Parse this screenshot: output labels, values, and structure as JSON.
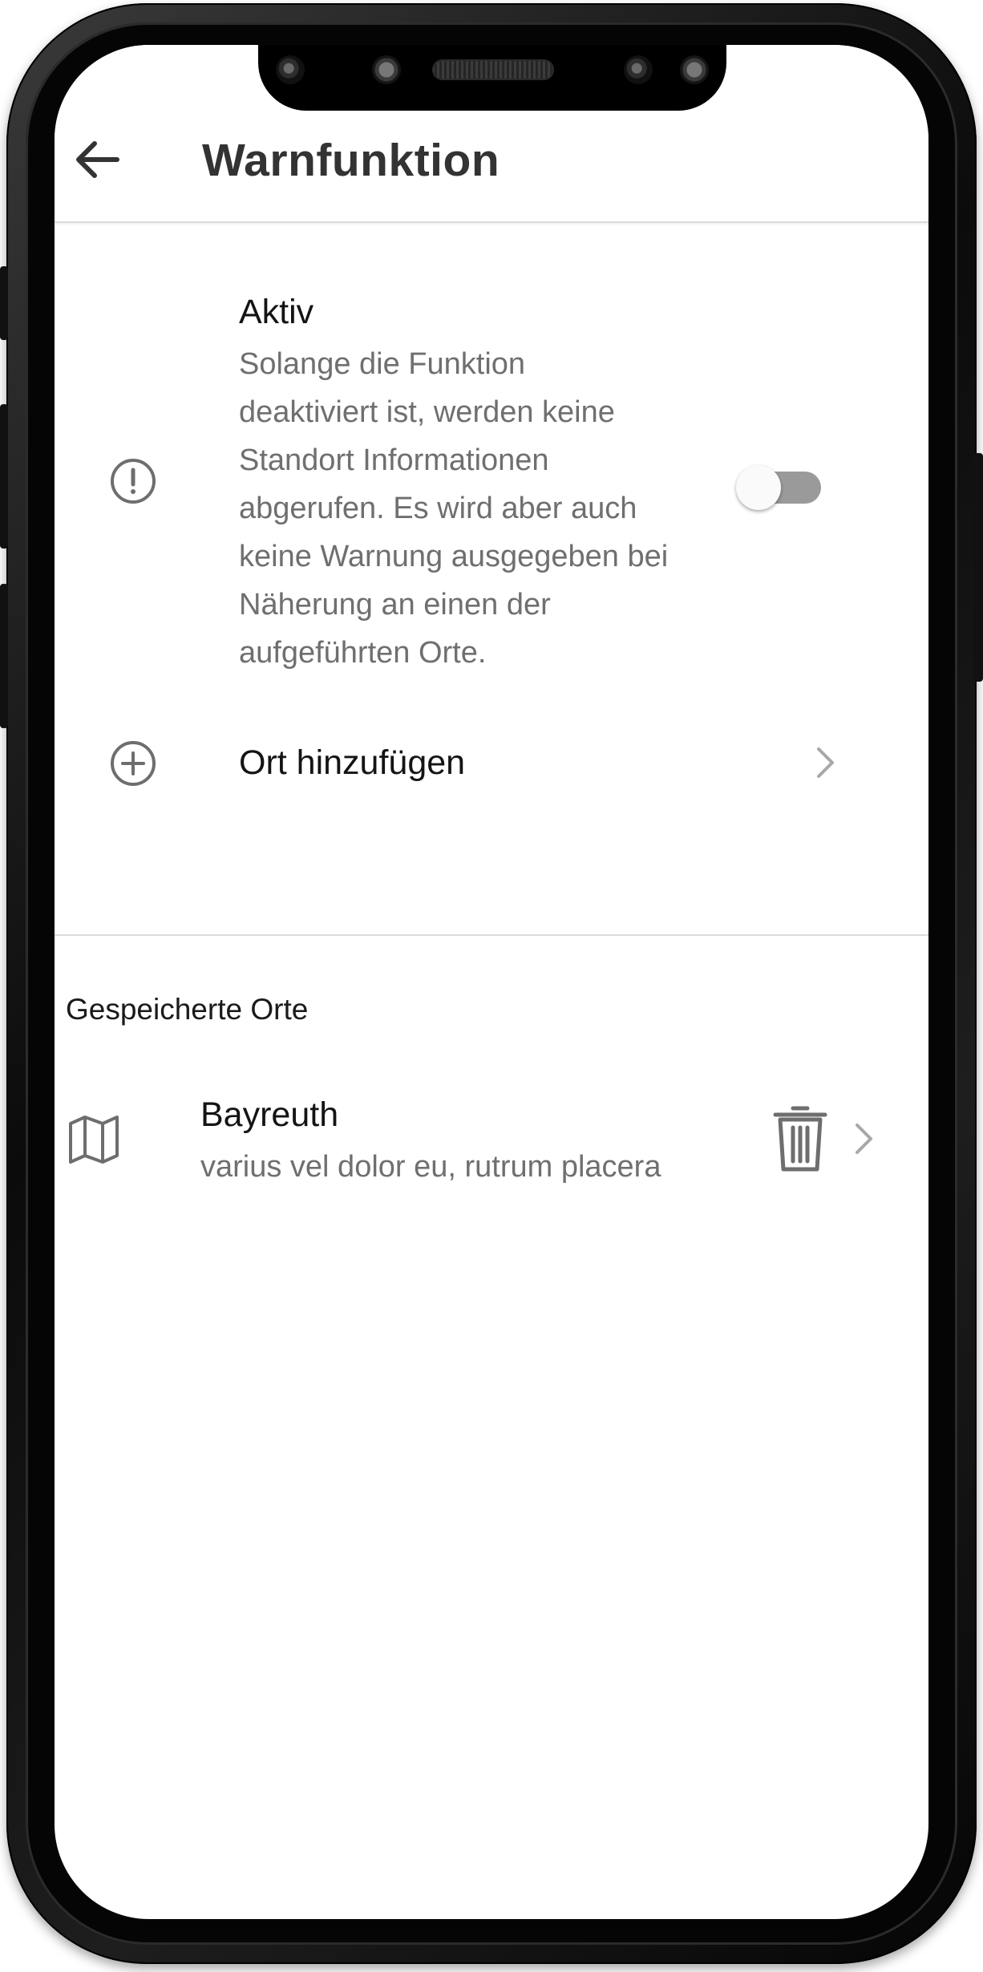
{
  "header": {
    "back_icon": "arrow-left-icon",
    "title": "Warnfunktion"
  },
  "settings": {
    "active": {
      "icon": "exclamation-circle-icon",
      "title": "Aktiv",
      "description_lines": [
        "Solange die Funktion",
        "deaktiviert ist, werden keine",
        "Standort Informationen",
        "abgerufen. Es wird aber auch",
        "keine Warnung ausgegeben bei",
        "Näherung an einen der",
        "aufgeführten Orte."
      ],
      "toggle_on": false
    },
    "add_location": {
      "icon": "plus-circle-icon",
      "label": "Ort hinzufügen",
      "chevron_icon": "chevron-right-icon"
    }
  },
  "saved_locations": {
    "header": "Gespeicherte Orte",
    "items": [
      {
        "icon": "map-icon",
        "name": "Bayreuth",
        "subtitle": "varius vel dolor eu, rutrum placera",
        "delete_icon": "trash-icon",
        "chevron_icon": "chevron-right-icon"
      }
    ]
  },
  "colors": {
    "title_text": "#333333",
    "body_text": "#141414",
    "secondary_text": "#6f6f6f",
    "icon": "#6e6e6e",
    "toggle_track": "#9a9a9a",
    "divider": "#dcdcdc"
  }
}
